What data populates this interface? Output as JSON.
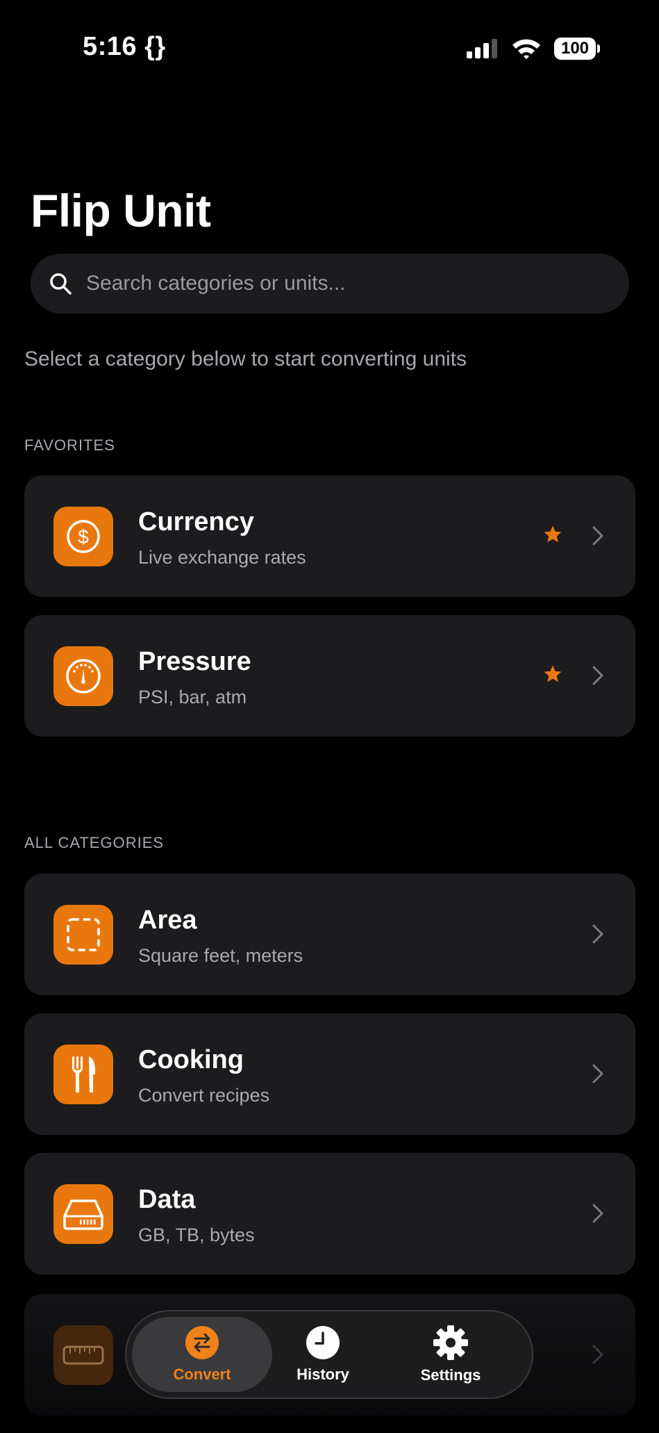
{
  "status": {
    "time": "5:16 {}",
    "battery": "100"
  },
  "app": {
    "title": "Flip Unit"
  },
  "search": {
    "placeholder": "Search categories or units..."
  },
  "intro": "Select a category below to start converting units",
  "favorites": {
    "label": "FAVORITES",
    "items": [
      {
        "name": "Currency",
        "sub": "Live exchange rates",
        "icon": "dollar-circle-icon",
        "favorite": true
      },
      {
        "name": "Pressure",
        "sub": "PSI, bar, atm",
        "icon": "gauge-icon",
        "favorite": true
      }
    ]
  },
  "all": {
    "label": "ALL CATEGORIES",
    "items": [
      {
        "name": "Area",
        "sub": "Square feet, meters",
        "icon": "dashed-square-icon"
      },
      {
        "name": "Cooking",
        "sub": "Convert recipes",
        "icon": "fork-knife-icon"
      },
      {
        "name": "Data",
        "sub": "GB, TB, bytes",
        "icon": "drive-icon"
      },
      {
        "name": "",
        "sub": "",
        "icon": "ruler-icon"
      }
    ]
  },
  "tabs": [
    {
      "label": "Convert",
      "icon": "convert-arrows-icon",
      "active": true
    },
    {
      "label": "History",
      "icon": "clock-icon"
    },
    {
      "label": "Settings",
      "icon": "gear-icon"
    }
  ],
  "colors": {
    "accent": "#e8780e",
    "card": "#1c1c1e",
    "background": "#000000"
  }
}
